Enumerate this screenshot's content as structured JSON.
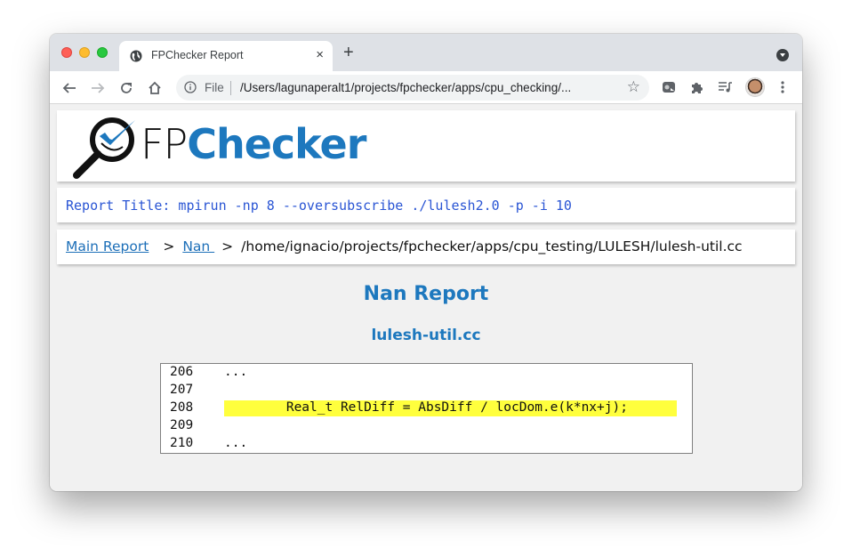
{
  "browser": {
    "tab": {
      "title": "FPChecker Report",
      "icon": "globe-icon",
      "close_label": "×"
    },
    "new_tab_label": "+",
    "omnibox": {
      "scheme": "File",
      "url": "/Users/lagunaperalt1/projects/fpchecker/apps/cpu_checking/..."
    },
    "nav": {
      "back": "arrow-left-icon",
      "forward": "arrow-right-icon",
      "reload": "reload-icon",
      "home": "home-icon"
    },
    "extensions": [
      "screen-capture-icon",
      "puzzle-icon",
      "media-queue-icon",
      "avatar",
      "kebab-menu-icon"
    ]
  },
  "page": {
    "logo": {
      "part1": "FP",
      "part2": "Checker"
    },
    "report_title": "Report Title: mpirun -np 8 --oversubscribe ./lulesh2.0 -p -i 10",
    "breadcrumb": {
      "items": [
        {
          "label": "Main Report",
          "link": true
        },
        {
          "label": "Nan ",
          "link": true
        },
        {
          "label": "/home/ignacio/projects/fpchecker/apps/cpu_testing/LULESH/lulesh-util.cc",
          "link": false
        }
      ],
      "separator": ">"
    },
    "heading": "Nan Report",
    "subheading": "lulesh-util.cc",
    "code": {
      "lines": [
        {
          "number": "206",
          "text": "...",
          "highlight": false
        },
        {
          "number": "207",
          "text": "",
          "highlight": false
        },
        {
          "number": "208",
          "text": "        Real_t RelDiff = AbsDiff / locDom.e(k*nx+j);",
          "highlight": true
        },
        {
          "number": "209",
          "text": "",
          "highlight": false
        },
        {
          "number": "210",
          "text": "...",
          "highlight": false
        }
      ],
      "highlight_color": "#ffff3d"
    }
  },
  "colors": {
    "brand_blue": "#1d78be",
    "report_title": "#2a55d4",
    "link": "#1d6fb8"
  }
}
